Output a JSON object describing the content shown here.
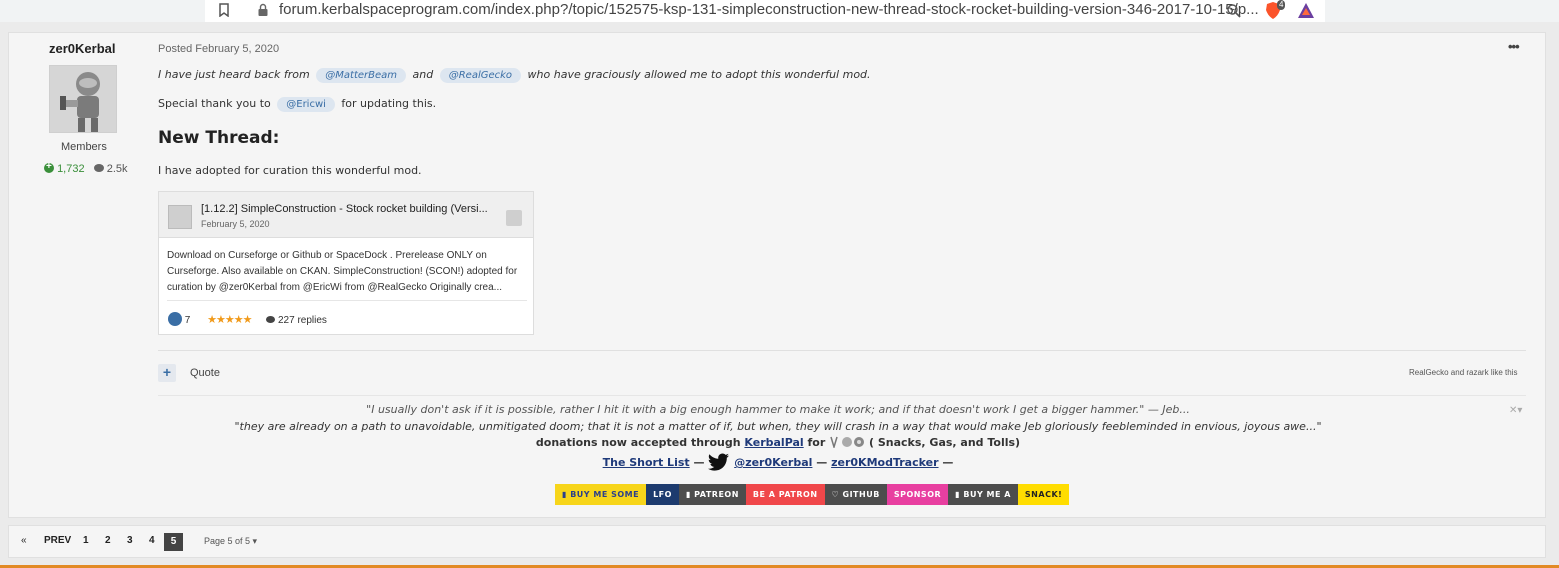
{
  "browser": {
    "url": "forum.kerbalspaceprogram.com/index.php?/topic/152575-ksp-131-simpleconstruction-new-thread-stock-rocket-building-version-346-2017-10-15/p...",
    "brave_badge": "4"
  },
  "post": {
    "author": {
      "name": "zer0Kerbal",
      "group": "Members",
      "reputation": "1,732",
      "posts": "2.5k"
    },
    "posted": "Posted February 5, 2020",
    "line1": {
      "before": "I have just heard back from",
      "mention1": "@MatterBeam",
      "and": "and",
      "mention2": "@RealGecko",
      "after": "who have graciously allowed me to adopt this wonderful mod."
    },
    "line2": {
      "before": "Special thank you to",
      "mention": "@Ericwi",
      "after": "for updating this."
    },
    "heading": "New Thread:",
    "line3": "I have adopted for curation this wonderful mod.",
    "embed": {
      "title": "[1.12.2] SimpleConstruction - Stock rocket building (Versi...",
      "date": "February 5, 2020",
      "body": "Download on Curseforge or Github or SpaceDock . Prerelease ONLY on Curseforge. Also available on CKAN. SimpleConstruction! (SCON!) adopted for curation by @zer0Kerbal from @EricWi from @RealGecko Originally crea...",
      "likes": "7",
      "stars": "★★★★★",
      "replies": "227 replies"
    },
    "actions": {
      "plus": "+",
      "quote": "Quote",
      "liked_by": "RealGecko and razark like this"
    },
    "signature": {
      "quote1": "\"I usually don't ask if it is possible, rather I hit it with a big enough hammer to make it work; and if that doesn't work I get a bigger hammer.\"  — Jeb...",
      "quote2": "\"they are already on a path to unavoidable, unmitigated doom; that it is not a matter of if, but when, they will crash in a way that would make Jeb gloriously feebleminded in envious, joyous awe...\"",
      "don_before": "donations now accepted through",
      "don_link": "KerbalPal",
      "don_for": "for",
      "don_after": "( Snacks, Gas, and Tolls)",
      "short_list": "The Short List",
      "dash": "—",
      "twitter": "@zer0Kerbal",
      "tracker": "zer0KModTracker",
      "badges": [
        {
          "text": "BUY ME SOME",
          "bg": "#f7d51a",
          "fg": "#2b3f8c"
        },
        {
          "text": "LFO",
          "bg": "#1d3b6e",
          "fg": "#ffffff"
        },
        {
          "text": "PATREON",
          "bg": "#4d4d4d",
          "fg": "#ffffff"
        },
        {
          "text": "BE A PATRON",
          "bg": "#f0474a",
          "fg": "#ffffff"
        },
        {
          "text": "GITHUB",
          "bg": "#4d4d4d",
          "fg": "#ffffff"
        },
        {
          "text": "SPONSOR",
          "bg": "#e83fa0",
          "fg": "#ffffff"
        },
        {
          "text": "BUY ME A",
          "bg": "#4d4d4d",
          "fg": "#ffffff"
        },
        {
          "text": "SNACK!",
          "bg": "#ffdd00",
          "fg": "#222222"
        }
      ]
    }
  },
  "pagination": {
    "prev_icon": "«",
    "prev": "PREV",
    "pages": [
      "1",
      "2",
      "3",
      "4"
    ],
    "current": "5",
    "page_of": "Page 5 of 5 ▾"
  }
}
